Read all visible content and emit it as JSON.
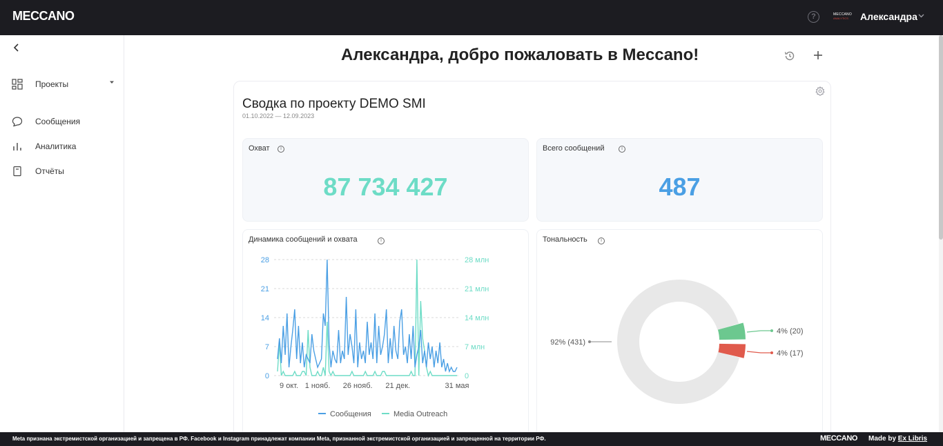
{
  "header": {
    "logo": "MECCANO",
    "brand_mini_top": "MECCANO",
    "brand_mini_bottom": "ANALYTICS",
    "user_name": "Александра",
    "help_glyph": "?",
    "icons": [
      "help-icon",
      "chevron-down-icon"
    ]
  },
  "sidebar": {
    "items": [
      {
        "label": "Проекты",
        "icon": "grid-icon"
      },
      {
        "label": "Сообщения",
        "icon": "chat-icon"
      },
      {
        "label": "Аналитика",
        "icon": "bar-chart-icon"
      },
      {
        "label": "Отчёты",
        "icon": "report-icon"
      }
    ]
  },
  "main": {
    "welcome": "Александра, добро пожаловать в Meccano!",
    "card": {
      "title": "Сводка по проекту DEMO SMI",
      "date_range": "01.10.2022 — 12.09.2023",
      "reach": {
        "label": "Охват",
        "value": "87 734 427",
        "color": "#6ddcc6"
      },
      "total": {
        "label": "Всего сообщений",
        "value": "487",
        "color": "#4a9fe4"
      },
      "dynamics_label": "Динамика сообщений и охвата",
      "tonality_label": "Тональность"
    }
  },
  "footer": {
    "note": "Meta признана экстремистской организацией и запрещена в РФ. Facebook и Instagram принадлежат компании Meta, признанной экстремистской организацией и запрещенной на территории РФ.",
    "logo": "MECCANO",
    "made_by": "Made by",
    "made_by_link": "Ex Libris"
  },
  "chart_data": [
    {
      "type": "line",
      "title": "Динамика сообщений и охвата",
      "x_ticks": [
        "9 окт.",
        "1 нояб.",
        "26 нояб.",
        "21 дек.",
        "31 мая"
      ],
      "y_left_ticks": [
        "0",
        "7",
        "14",
        "21",
        "28"
      ],
      "y_right_ticks": [
        "0",
        "7 млн",
        "14 млн",
        "21 млн",
        "28 млн"
      ],
      "ylim_left": [
        0,
        28
      ],
      "ylim_right_millions": [
        0,
        28
      ],
      "grid": true,
      "legend_placement": "bottom",
      "series": [
        {
          "name": "Сообщения",
          "axis": "left",
          "color": "#4a9fe4",
          "values": [
            4,
            9,
            3,
            12,
            5,
            15,
            2,
            7,
            11,
            16,
            4,
            12,
            3,
            8,
            2,
            5,
            4,
            3,
            10,
            6,
            4,
            2,
            3,
            4,
            15,
            12,
            28,
            8,
            2,
            6,
            4,
            3,
            11,
            3,
            6,
            4,
            19,
            5,
            10,
            7,
            3,
            16,
            2,
            8,
            4,
            6,
            3,
            13,
            5,
            8,
            4,
            15,
            3,
            12,
            5,
            7,
            10,
            16,
            3,
            9,
            4,
            12,
            6,
            4,
            13,
            16,
            5,
            7,
            3,
            10,
            4,
            12,
            2,
            5,
            7,
            11,
            3,
            6,
            2,
            8,
            4,
            7,
            2,
            6,
            3,
            8,
            2,
            4,
            1,
            3,
            1,
            2,
            1,
            1,
            2
          ]
        },
        {
          "name": "Media Outreach",
          "axis": "right",
          "unit": "млн",
          "color": "#6ddcc6",
          "values": [
            1,
            8,
            0,
            1,
            0,
            0,
            0,
            0,
            0,
            1,
            0,
            0,
            0,
            1,
            1,
            0,
            11,
            2,
            0,
            0,
            0,
            1,
            0,
            0,
            2,
            0,
            13,
            1,
            0,
            1,
            0,
            0,
            0,
            0,
            0,
            0,
            0,
            0,
            0,
            1,
            0,
            0,
            0,
            0,
            0,
            0,
            1,
            0,
            0,
            0,
            0,
            1,
            0,
            0,
            0,
            1,
            1,
            0,
            0,
            0,
            0,
            0,
            0,
            0,
            0,
            0,
            0,
            0,
            0,
            0,
            1,
            0,
            0,
            28,
            0,
            18,
            9,
            6,
            2,
            0,
            1,
            0,
            0,
            0,
            0,
            0,
            0,
            0,
            0,
            0,
            0,
            0,
            0,
            0,
            0
          ]
        }
      ]
    },
    {
      "type": "pie",
      "title": "Тональность",
      "donut": true,
      "slices": [
        {
          "label": "92% (431)",
          "value": 431,
          "percent": 92,
          "color": "#e8e8e8"
        },
        {
          "label": "4% (20)",
          "value": 20,
          "percent": 4,
          "color": "#6cc88f"
        },
        {
          "label": "4% (17)",
          "value": 17,
          "percent": 4,
          "color": "#e05a4c"
        }
      ]
    }
  ]
}
